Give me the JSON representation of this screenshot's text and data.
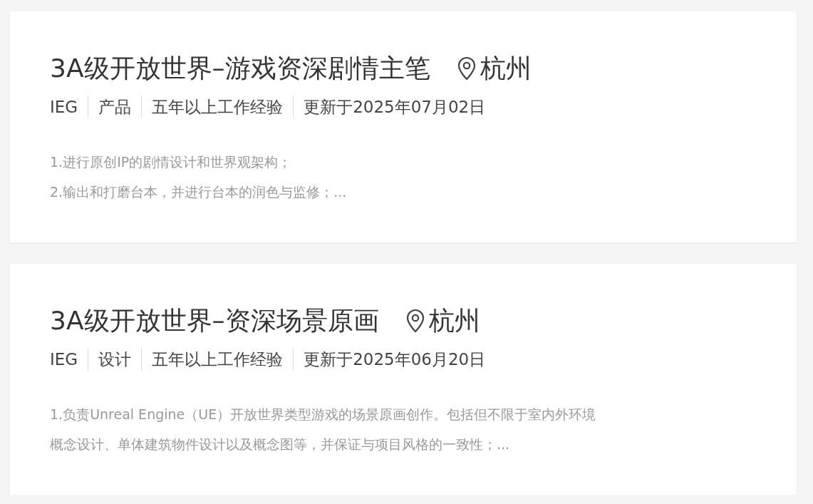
{
  "jobs": [
    {
      "title": "3A级开放世界–游戏资深剧情主笔",
      "location": "杭州",
      "meta": [
        "IEG",
        "产品",
        "五年以上工作经验",
        "更新于2025年07月02日"
      ],
      "description": [
        "1.进行原创IP的剧情设计和世界观架构；",
        "2.输出和打磨台本，并进行台本的润色与监修；..."
      ]
    },
    {
      "title": "3A级开放世界–资深场景原画",
      "location": "杭州",
      "meta": [
        "IEG",
        "设计",
        "五年以上工作经验",
        "更新于2025年06月20日"
      ],
      "description": [
        "1.负责Unreal Engine（UE）开放世界类型游戏的场景原画创作。包括但不限于室内外环境",
        "概念设计、单体建筑物件设计以及概念图等，并保证与项目风格的一致性；..."
      ]
    }
  ]
}
